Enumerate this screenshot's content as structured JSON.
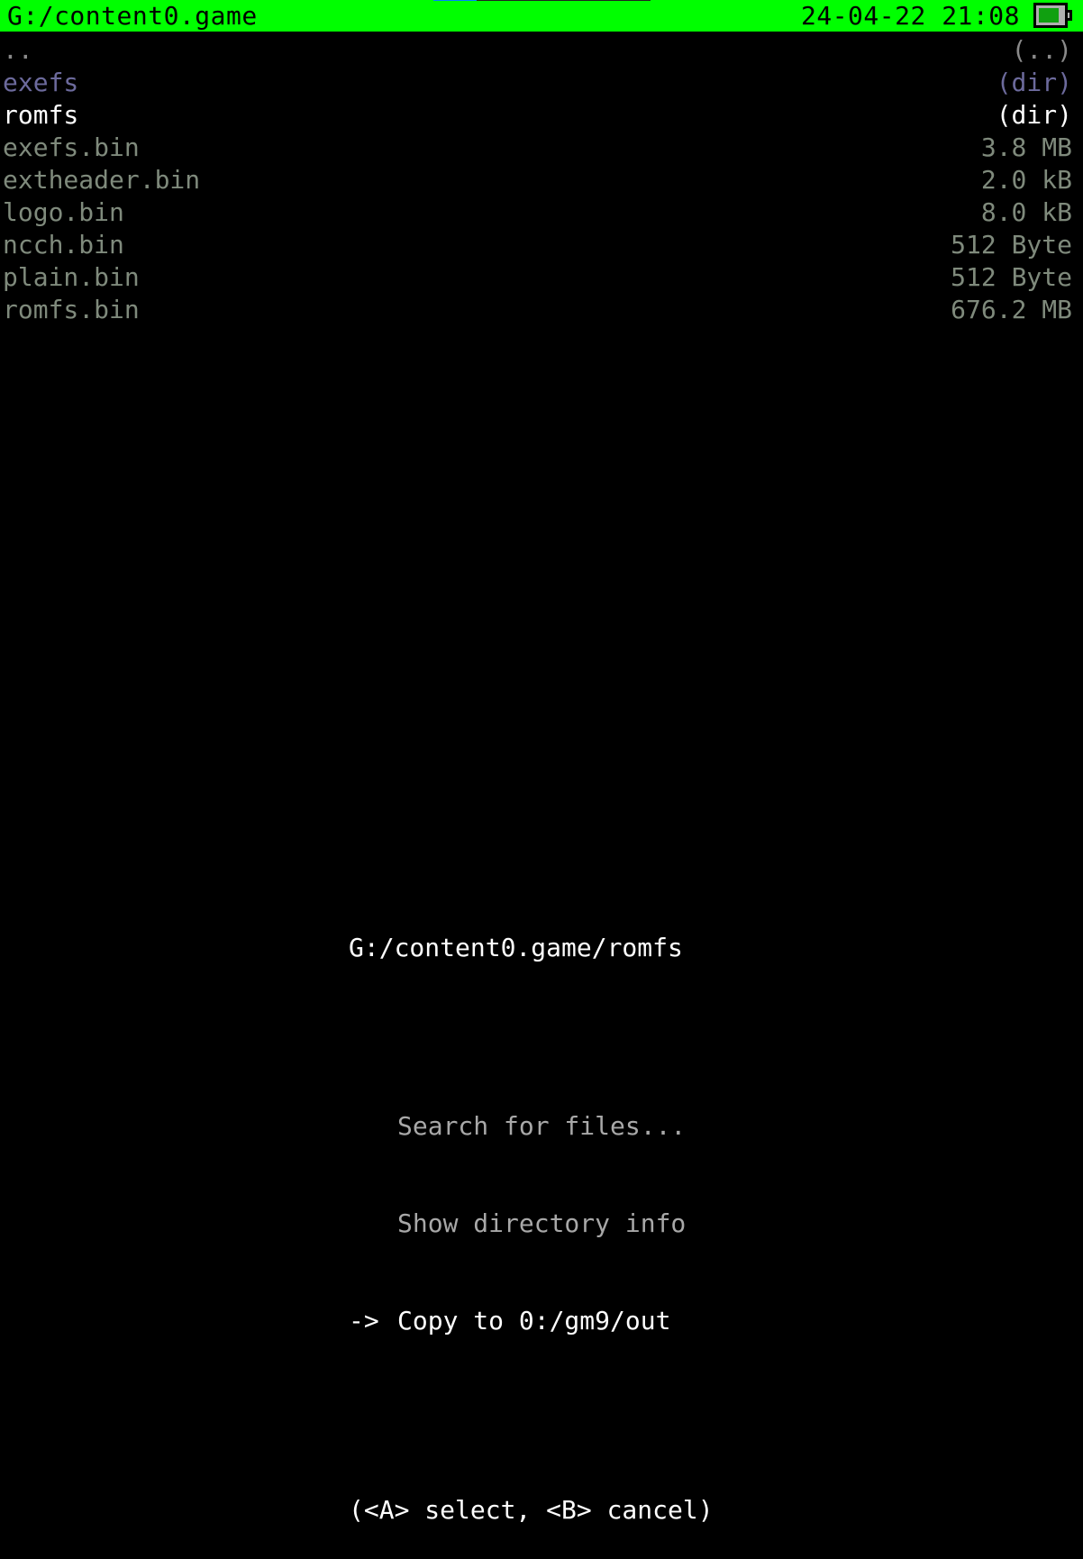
{
  "topbar": {
    "path": "G:/content0.game",
    "datetime": "24-04-22 21:08",
    "battery_icon": "battery-icon",
    "battery_level": 0.85,
    "progress": 0.2,
    "colors": {
      "bar": "#00ff00",
      "progress_fill": "#0080ff"
    }
  },
  "files": [
    {
      "name": "..",
      "size": "(..)",
      "type": "parent"
    },
    {
      "name": "exefs",
      "size": "(dir)",
      "type": "dir"
    },
    {
      "name": "romfs",
      "size": "(dir)",
      "type": "selected"
    },
    {
      "name": "exefs.bin",
      "size": "3.8 MB",
      "type": "file"
    },
    {
      "name": "extheader.bin",
      "size": "2.0 kB",
      "type": "file"
    },
    {
      "name": "logo.bin",
      "size": "8.0 kB",
      "type": "file"
    },
    {
      "name": "ncch.bin",
      "size": "512 Byte",
      "type": "file"
    },
    {
      "name": "plain.bin",
      "size": "512 Byte",
      "type": "file"
    },
    {
      "name": "romfs.bin",
      "size": "676.2 MB",
      "type": "file"
    }
  ],
  "menu": {
    "title": "G:/content0.game/romfs",
    "cursor": "->",
    "options": [
      {
        "label": "Search for files...",
        "active": false
      },
      {
        "label": "Show directory info",
        "active": false
      },
      {
        "label": "Copy to 0:/gm9/out",
        "active": true
      }
    ],
    "hint": "(<A> select, <B> cancel)"
  }
}
